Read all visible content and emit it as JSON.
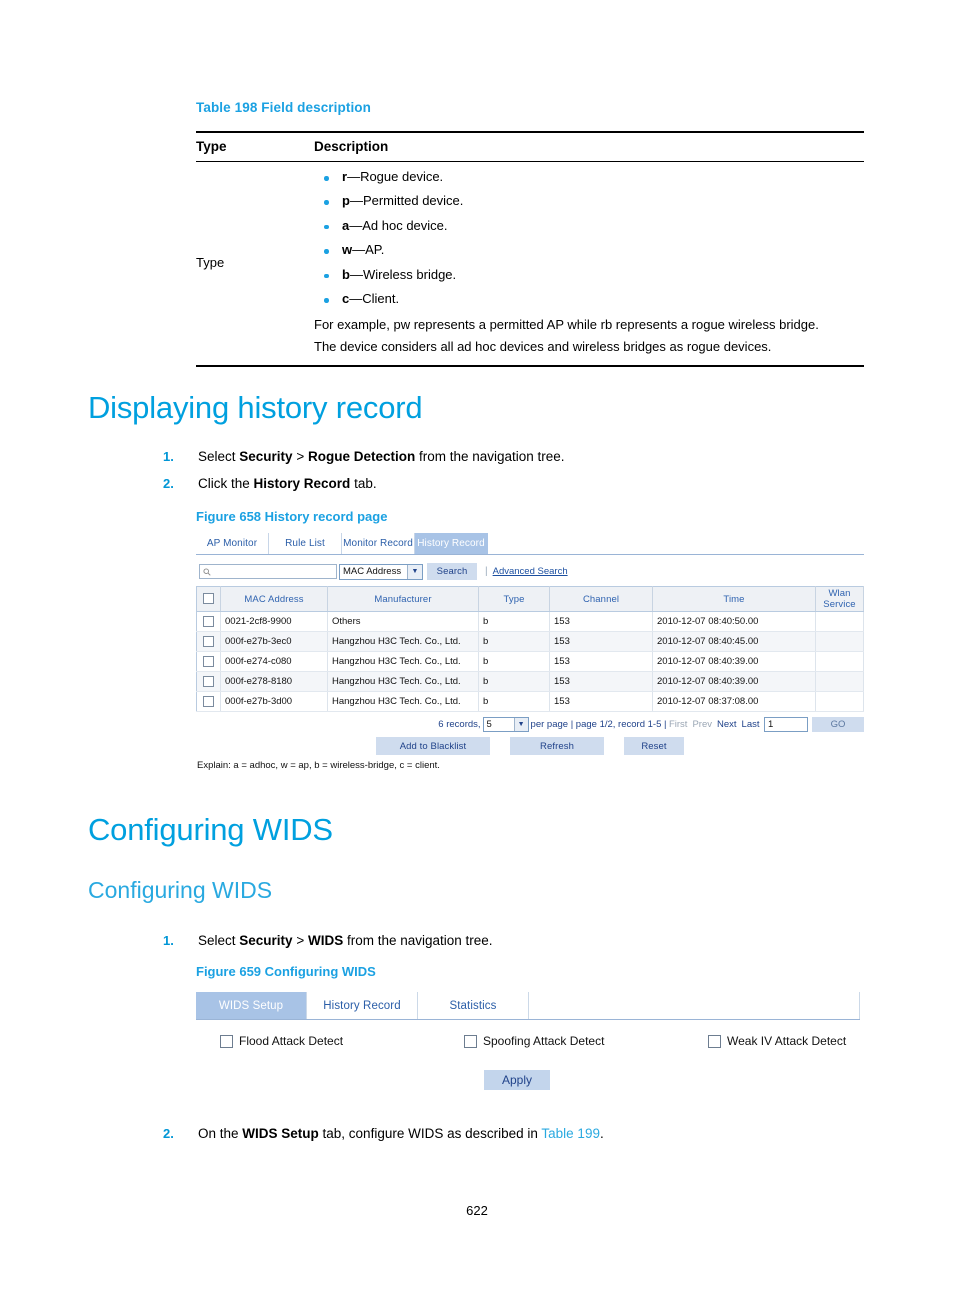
{
  "table198": {
    "caption": "Table 198 Field description",
    "headers": [
      "Type",
      "Description"
    ],
    "row_label": "Type",
    "bullets": [
      {
        "code": "r",
        "text": "—Rogue device."
      },
      {
        "code": "p",
        "text": "—Permitted device."
      },
      {
        "code": "a",
        "text": "—Ad hoc device."
      },
      {
        "code": "w",
        "text": "—AP."
      },
      {
        "code": "b",
        "text": "—Wireless bridge."
      },
      {
        "code": "c",
        "text": "—Client."
      }
    ],
    "paragraphs": [
      "For example, pw represents a permitted AP while rb represents a rogue wireless bridge.",
      "The device considers all ad hoc devices and wireless bridges as rogue devices."
    ]
  },
  "section_history": {
    "heading": "Displaying history record",
    "step1": {
      "num": "1.",
      "pre": "Select ",
      "b1": "Security",
      "mid": " > ",
      "b2": "Rogue Detection",
      "post": " from the navigation tree."
    },
    "step2": {
      "num": "2.",
      "pre": "Click the ",
      "b1": "History Record",
      "post": " tab."
    },
    "figure_caption": "Figure 658 History record page"
  },
  "shot658": {
    "tabs": [
      {
        "label": "AP Monitor",
        "active": false
      },
      {
        "label": "Rule List",
        "active": false
      },
      {
        "label": "Monitor Record",
        "active": false
      },
      {
        "label": "History Record",
        "active": true
      }
    ],
    "search": {
      "input_value": "",
      "input_icon": "search-icon",
      "select_value": "MAC Address",
      "button_label": "Search",
      "separator": "|",
      "advanced_link": "Advanced Search"
    },
    "table": {
      "headers": [
        "MAC Address",
        "Manufacturer",
        "Type",
        "Channel",
        "Time",
        "Wlan Service"
      ],
      "rows": [
        {
          "mac": "0021-2cf8-9900",
          "manufacturer": "Others",
          "type": "b",
          "channel": "153",
          "time": "2010-12-07 08:40:50.00",
          "wlan": ""
        },
        {
          "mac": "000f-e27b-3ec0",
          "manufacturer": "Hangzhou H3C Tech. Co., Ltd.",
          "type": "b",
          "channel": "153",
          "time": "2010-12-07 08:40:45.00",
          "wlan": ""
        },
        {
          "mac": "000f-e274-c080",
          "manufacturer": "Hangzhou H3C Tech. Co., Ltd.",
          "type": "b",
          "channel": "153",
          "time": "2010-12-07 08:40:39.00",
          "wlan": ""
        },
        {
          "mac": "000f-e278-8180",
          "manufacturer": "Hangzhou H3C Tech. Co., Ltd.",
          "type": "b",
          "channel": "153",
          "time": "2010-12-07 08:40:39.00",
          "wlan": ""
        },
        {
          "mac": "000f-e27b-3d00",
          "manufacturer": "Hangzhou H3C Tech. Co., Ltd.",
          "type": "b",
          "channel": "153",
          "time": "2010-12-07 08:37:08.00",
          "wlan": ""
        }
      ]
    },
    "pagination": {
      "records_text": "6 records,",
      "per_page_value": "5",
      "per_page_text": "per page | page 1/2, record 1-5 |",
      "first": "First",
      "prev": "Prev",
      "next": "Next",
      "last": "Last",
      "page_input_value": "1",
      "go_label": "GO"
    },
    "actions": {
      "blacklist": "Add to Blacklist",
      "refresh": "Refresh",
      "reset": "Reset"
    },
    "explain": "Explain: a = adhoc, w = ap, b = wireless-bridge, c = client."
  },
  "section_wids": {
    "heading1": "Configuring WIDS",
    "heading2": "Configuring WIDS",
    "step1": {
      "num": "1.",
      "pre": "Select ",
      "b1": "Security",
      "mid": " > ",
      "b2": "WIDS",
      "post": " from the navigation tree."
    },
    "figure_caption": "Figure 659 Configuring WIDS",
    "step2": {
      "num": "2.",
      "pre": "On the ",
      "b1": "WIDS Setup",
      "mid": " tab, configure WIDS as described in ",
      "link": "Table 199",
      "post": "."
    }
  },
  "shot659": {
    "tabs": [
      {
        "label": "WIDS Setup",
        "active": true
      },
      {
        "label": "History Record",
        "active": false
      },
      {
        "label": "Statistics",
        "active": false
      }
    ],
    "checkboxes": [
      {
        "label": "Flood Attack Detect",
        "checked": false
      },
      {
        "label": "Spoofing Attack Detect",
        "checked": false
      },
      {
        "label": "Weak IV Attack Detect",
        "checked": false
      }
    ],
    "apply_label": "Apply"
  },
  "footer": {
    "page_number": "622"
  },
  "colors": {
    "heading_blue": "#00a0df",
    "caption_blue": "#1ba1e2",
    "step_number_blue": "#0096d6",
    "tab_active_bg": "#a8c3e6",
    "button_bg": "#cfdcee",
    "table_header_bg": "#eef1f5",
    "table_header_text": "#2f63b0"
  }
}
